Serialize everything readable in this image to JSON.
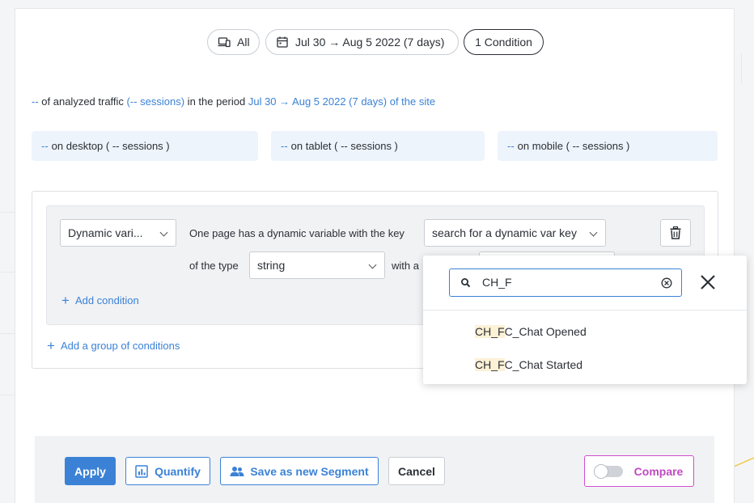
{
  "filters": {
    "device_label": "All",
    "date_label": "Jul 30 → Aug 5 2022 (7 days)",
    "condition_label": "1 Condition"
  },
  "summary": {
    "value": "--",
    "text1": " of analyzed traffic ",
    "sessions": "(-- sessions)",
    "text2": " in the period ",
    "period": "Jul 30 → Aug 5 2022 (7 days) of the site"
  },
  "devices": [
    {
      "value": "--",
      "text": "on desktop ( -- sessions )"
    },
    {
      "value": "--",
      "text": "on tablet ( -- sessions )"
    },
    {
      "value": "--",
      "text": "on mobile ( -- sessions )"
    }
  ],
  "condition": {
    "type_select": "Dynamic vari...",
    "sentence1": "One page has a dynamic variable with the key",
    "key_select": "search for a dynamic var key",
    "sentence2": "of the type",
    "type_value": "string",
    "sentence3": "with a",
    "add_condition": "Add condition",
    "add_group": "Add a group of conditions"
  },
  "dropdown": {
    "search_value": "CH_F",
    "items": [
      {
        "match": "CH_F",
        "rest": "C_Chat Opened"
      },
      {
        "match": "CH_F",
        "rest": "C_Chat Started"
      }
    ]
  },
  "footer": {
    "apply": "Apply",
    "quantify": "Quantify",
    "save_segment": "Save as new Segment",
    "cancel": "Cancel",
    "compare": "Compare"
  },
  "colors": {
    "accent": "#3b82d6",
    "compare": "#c04ac2",
    "highlight": "#fdf1d6"
  }
}
